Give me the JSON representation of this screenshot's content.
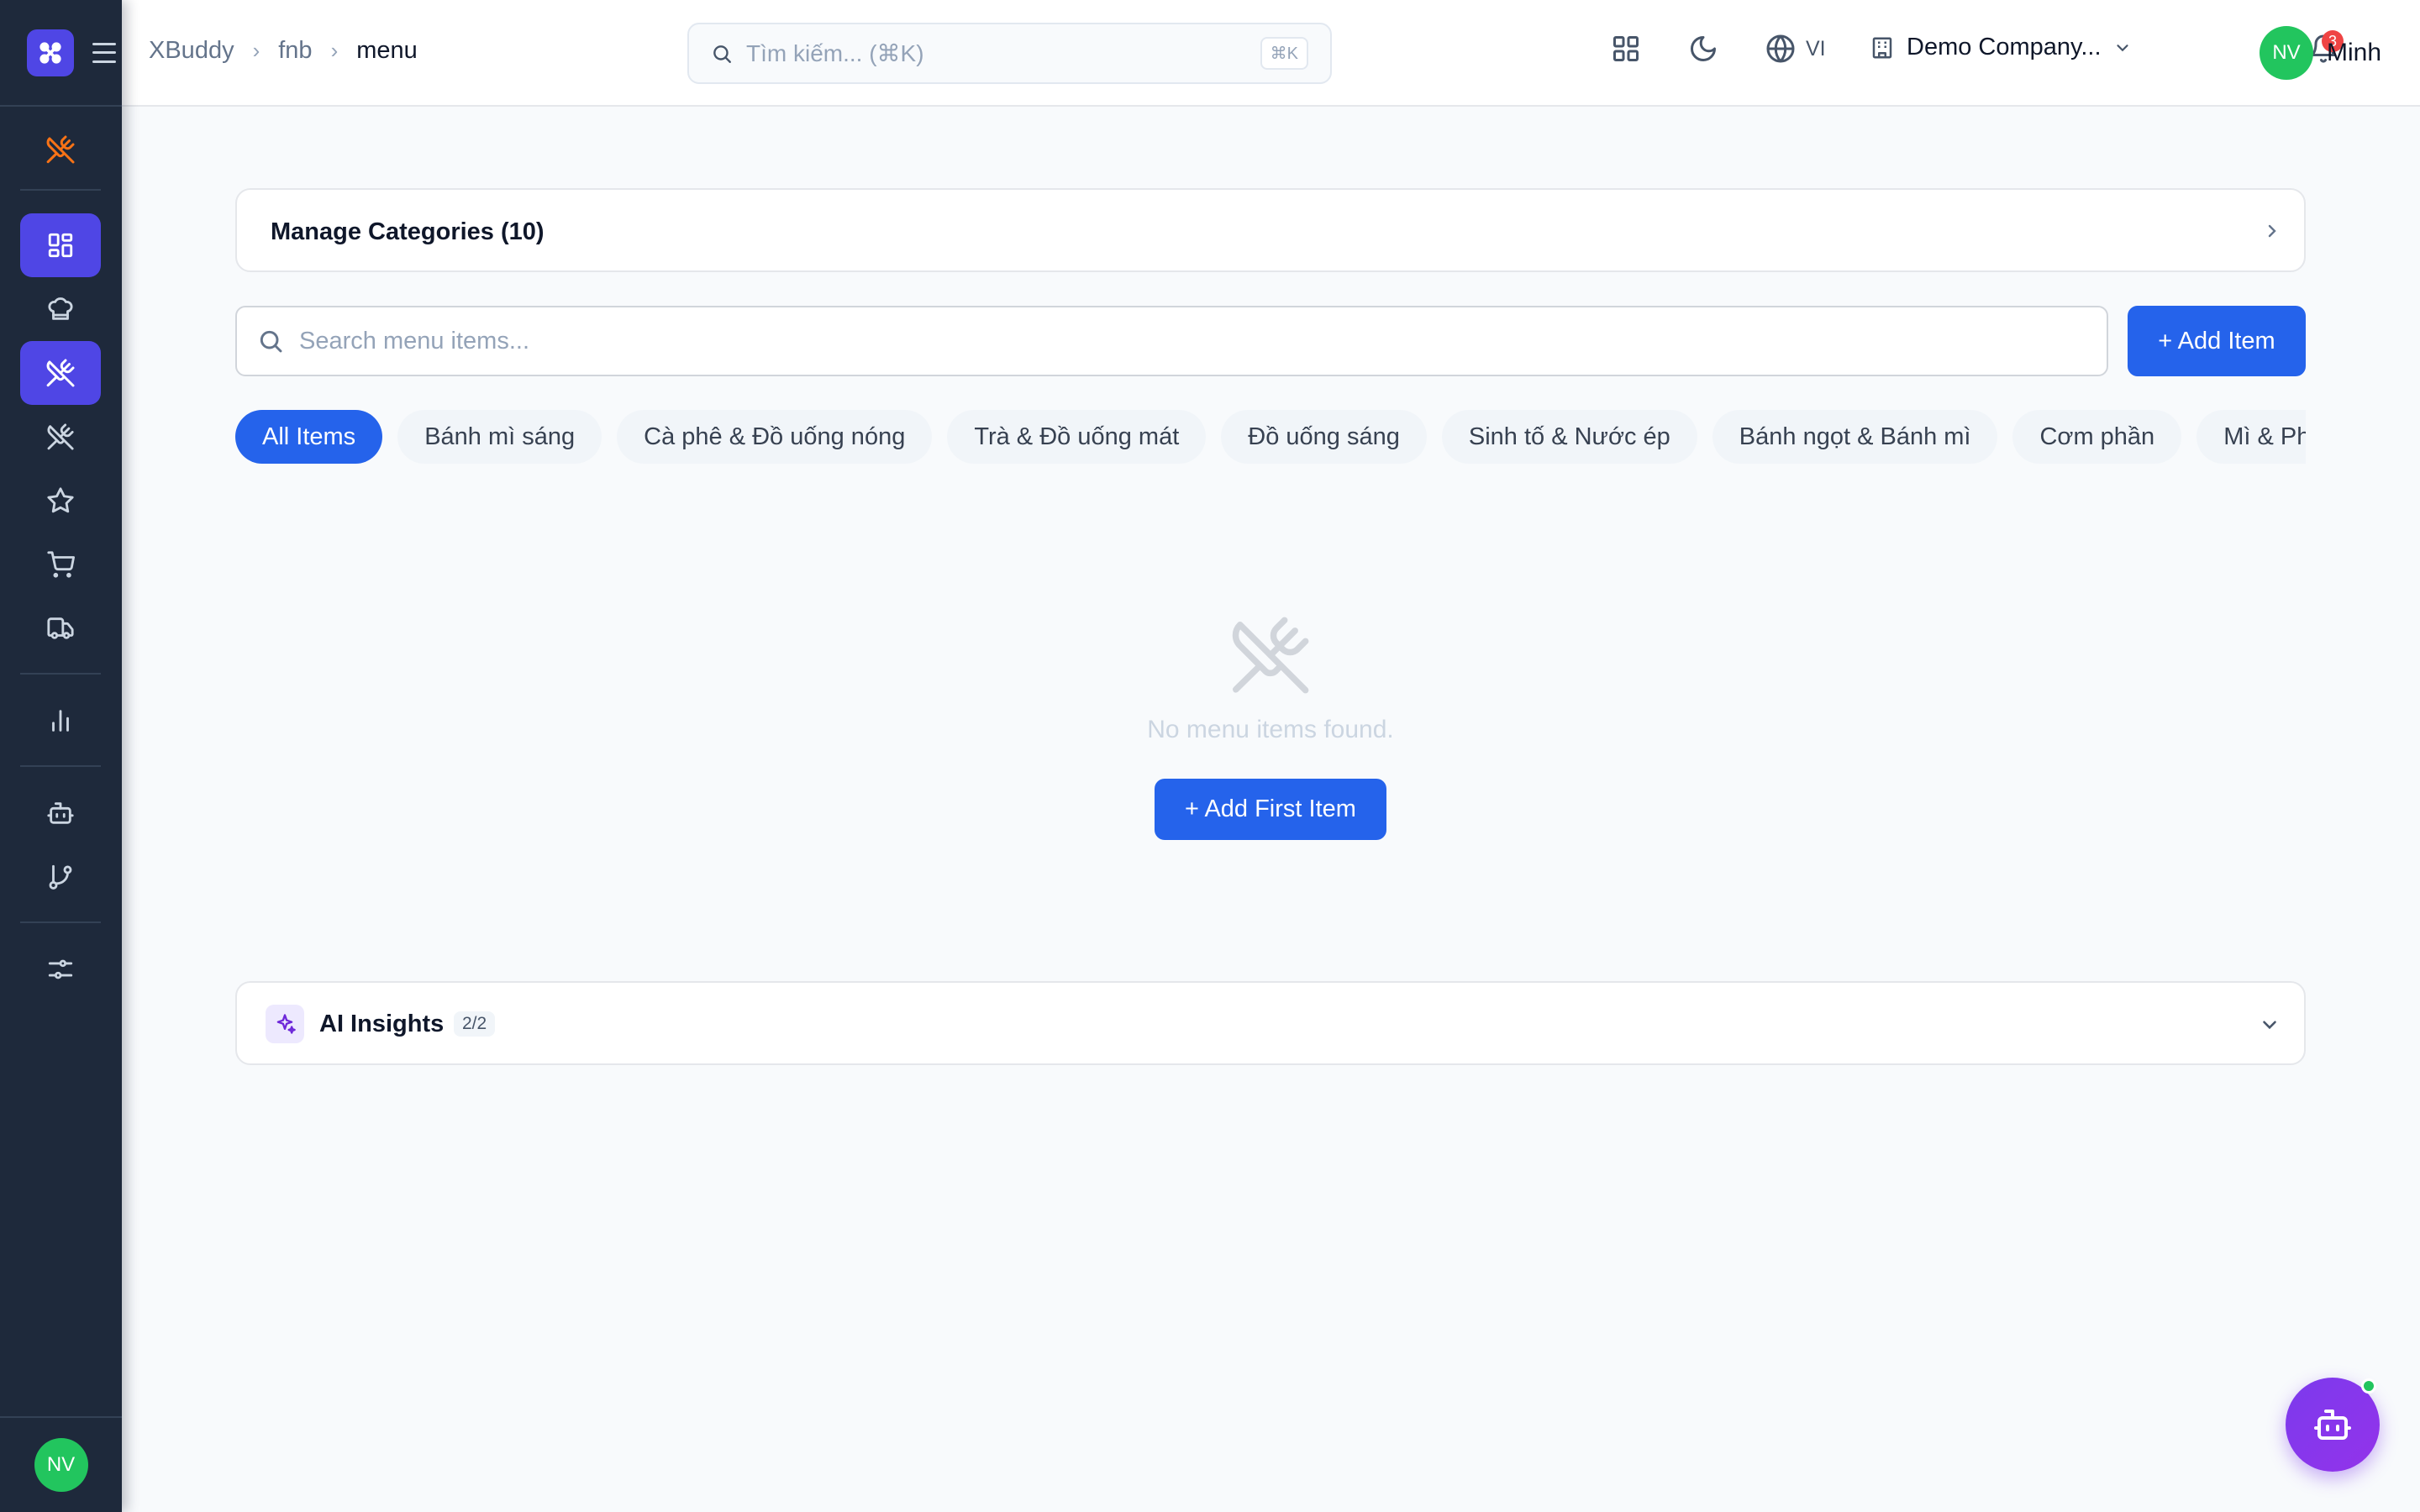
{
  "sidebar": {
    "items": [
      {
        "name": "fnb-brand-icon",
        "icon": "utensils-crossed-icon",
        "active": false,
        "color": "#f97316"
      },
      {
        "name": "dashboard",
        "icon": "layout-grid-icon",
        "active": true
      },
      {
        "name": "kitchen",
        "icon": "chef-hat-icon",
        "active": false
      },
      {
        "name": "menu",
        "icon": "utensils-crossed-icon",
        "active": true
      },
      {
        "name": "recipes",
        "icon": "utensils-icon",
        "active": false
      },
      {
        "name": "favorites",
        "icon": "star-icon",
        "active": false
      },
      {
        "name": "orders",
        "icon": "shopping-cart-icon",
        "active": false
      },
      {
        "name": "delivery",
        "icon": "truck-icon",
        "active": false
      },
      {
        "name": "reports",
        "icon": "bar-chart-icon",
        "active": false
      },
      {
        "name": "ai-bot",
        "icon": "bot-icon",
        "active": false
      },
      {
        "name": "workflows",
        "icon": "git-branch-icon",
        "active": false
      },
      {
        "name": "settings",
        "icon": "sliders-icon",
        "active": false
      }
    ],
    "user_initials": "NV"
  },
  "header": {
    "breadcrumb": [
      "XBuddy",
      "fnb",
      "menu"
    ],
    "search_placeholder": "Tìm kiếm... (⌘K)",
    "search_shortcut": "⌘K",
    "language": "VI",
    "company": "Demo Company...",
    "notification_count": "3",
    "user_initials": "NV",
    "user_name": "Minh"
  },
  "main": {
    "categories_card_title": "Manage Categories (10)",
    "search_placeholder": "Search menu items...",
    "add_item_label": "+ Add Item",
    "chips": [
      {
        "label": "All Items",
        "active": true
      },
      {
        "label": "Bánh mì sáng",
        "active": false
      },
      {
        "label": "Cà phê & Đồ uống nóng",
        "active": false
      },
      {
        "label": "Trà & Đồ uống mát",
        "active": false
      },
      {
        "label": "Đồ uống sáng",
        "active": false
      },
      {
        "label": "Sinh tố & Nước ép",
        "active": false
      },
      {
        "label": "Bánh ngọt & Bánh mì",
        "active": false
      },
      {
        "label": "Cơm phần",
        "active": false
      },
      {
        "label": "Mì & Phở",
        "active": false
      }
    ],
    "empty_text": "No menu items found.",
    "add_first_label": "+ Add First Item",
    "ai_insights": {
      "title": "AI Insights",
      "count": "2/2"
    }
  },
  "colors": {
    "sidebar_bg": "#1e293b",
    "sidebar_active": "#4f46e5",
    "primary": "#2563eb",
    "avatar": "#22c55e",
    "badge": "#ef4444",
    "bot_fab": "#7c3aed"
  }
}
